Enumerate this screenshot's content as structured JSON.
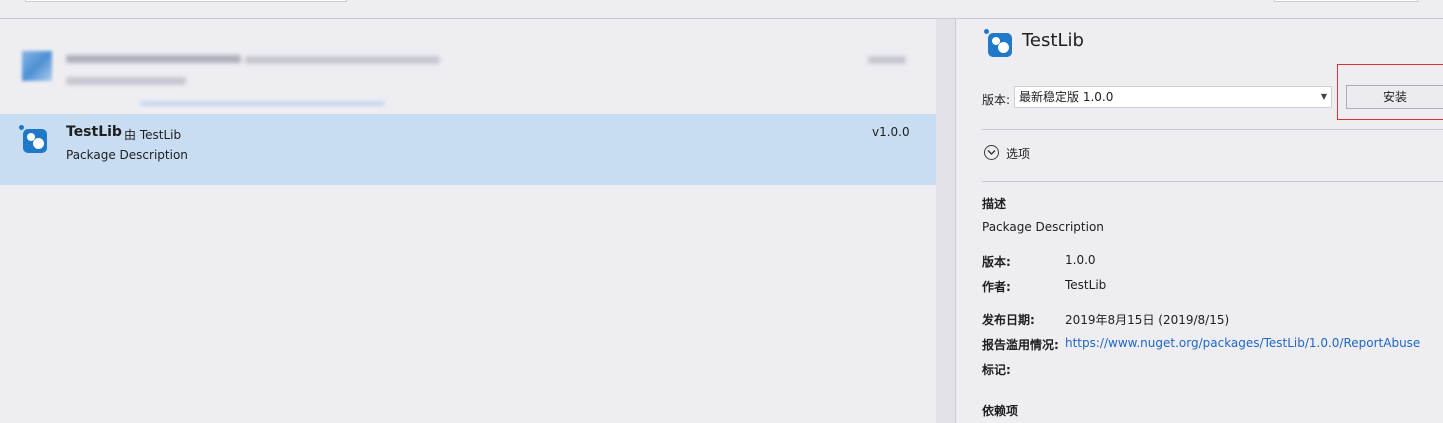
{
  "package_list": {
    "items": [
      {
        "name": "TestLib",
        "author_prefix": "由",
        "author": "TestLib",
        "description": "Package Description",
        "version": "v1.0.0",
        "selected": true
      }
    ]
  },
  "details": {
    "title": "TestLib",
    "version_label": "版本:",
    "version_selected": "最新稳定版 1.0.0",
    "install_label": "安装",
    "options_label": "选项",
    "description_heading": "描述",
    "description": "Package Description",
    "meta": {
      "version_key": "版本:",
      "version_value": "1.0.0",
      "author_key": "作者:",
      "author_value": "TestLib",
      "publish_date_key": "发布日期:",
      "publish_date_value": "2019年8月15日 (2019/8/15)",
      "report_abuse_key": "报告滥用情况:",
      "report_abuse_url": "https://www.nuget.org/packages/TestLib/1.0.0/ReportAbuse",
      "tags_key": "标记:"
    },
    "dependencies_heading": "依赖项"
  },
  "colors": {
    "selection": "#c9ddf2",
    "background": "#eeeef2",
    "link": "#1e67c4",
    "highlight_border": "#e03030",
    "package_icon": "#1f78c8"
  }
}
